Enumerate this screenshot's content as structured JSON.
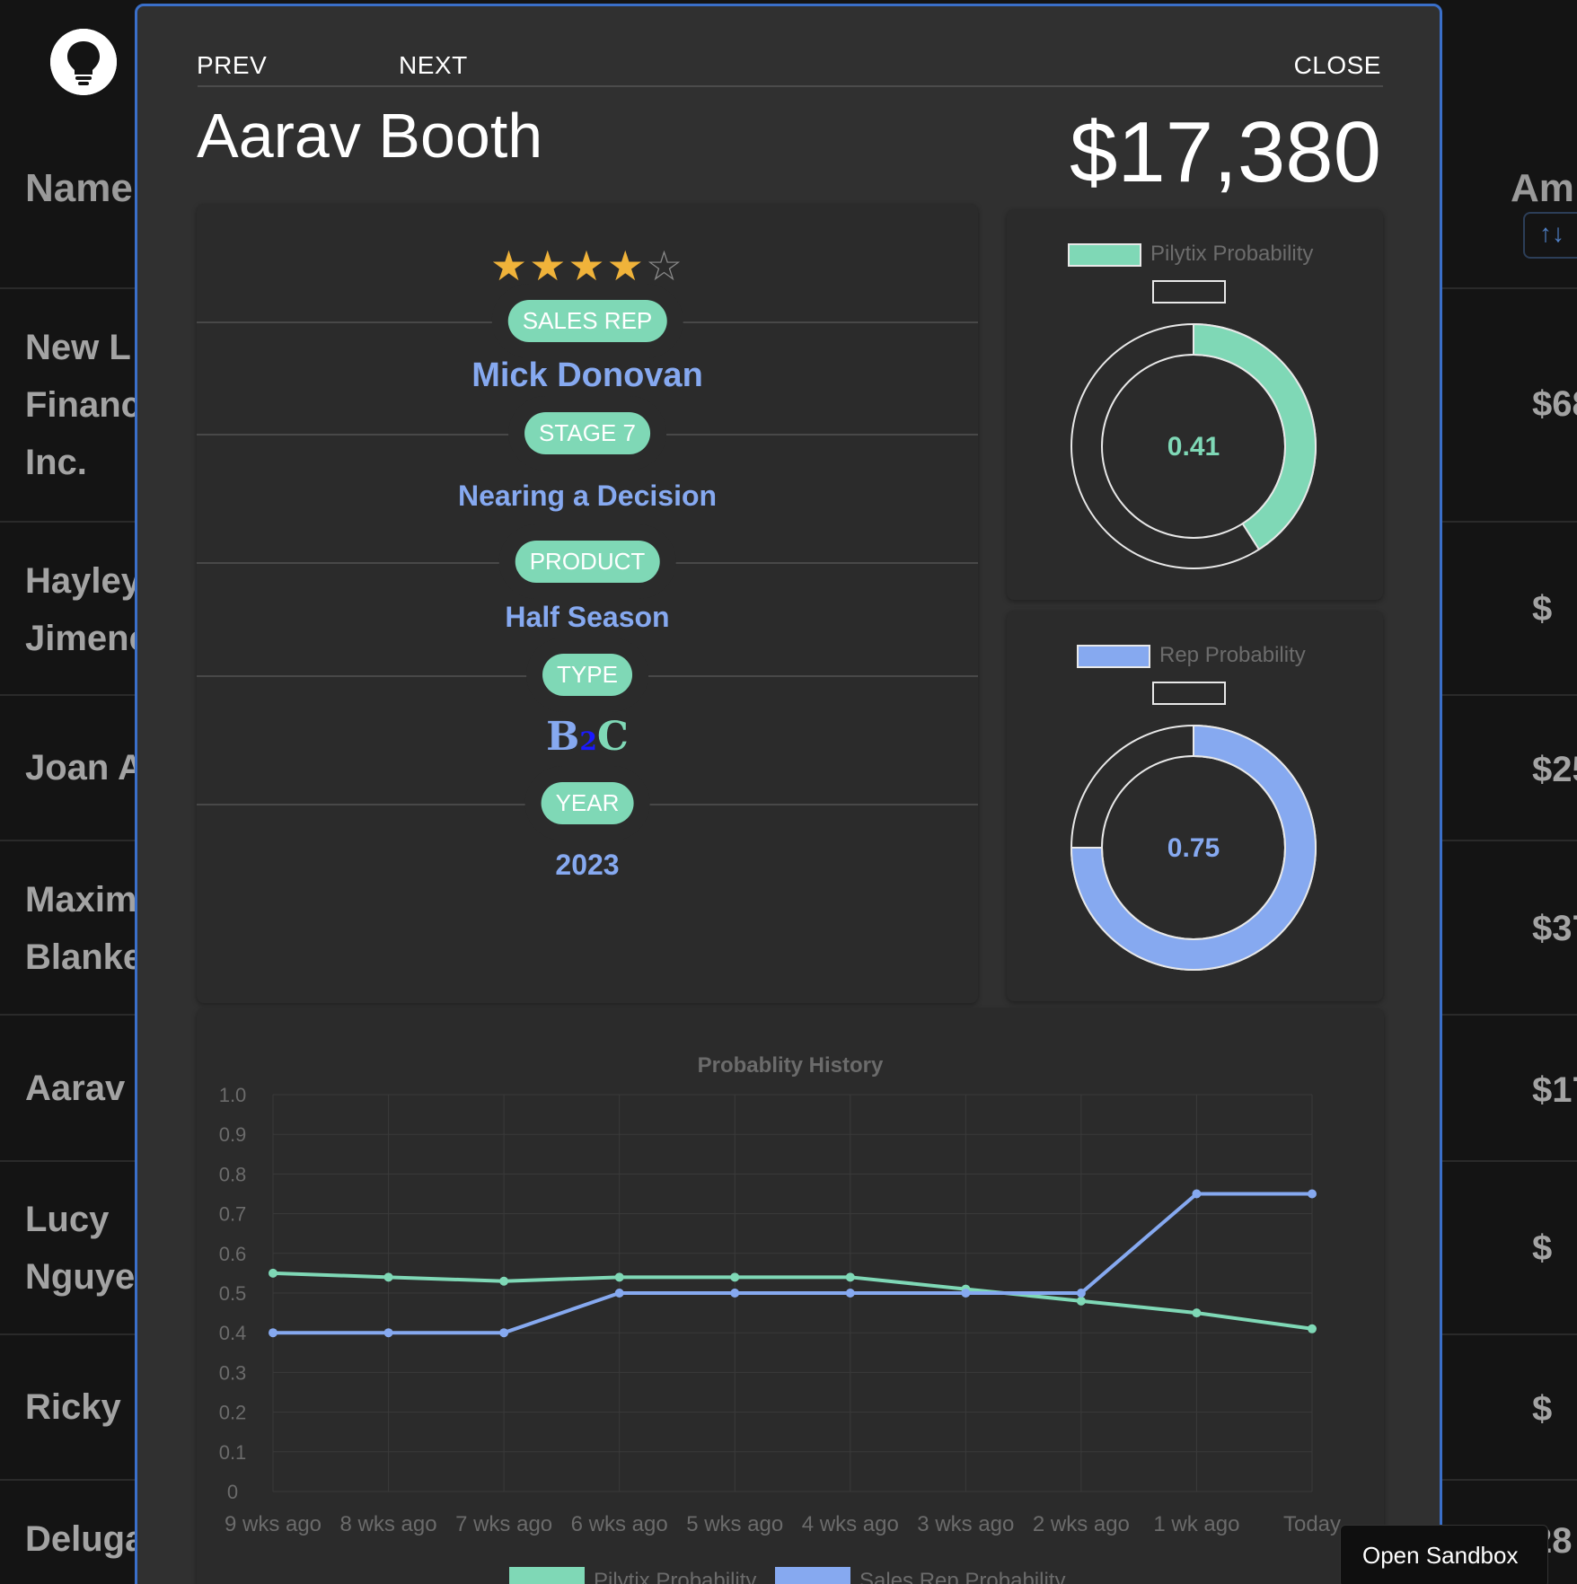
{
  "background": {
    "headers": {
      "name": "Name",
      "amount": "Am"
    },
    "rows": [
      {
        "name": "New L\nFinanc\nInc.",
        "amount": "$68"
      },
      {
        "name": "Hayley\nJimene",
        "amount": "$"
      },
      {
        "name": "Joan A",
        "amount": "$25"
      },
      {
        "name": "Maxim\nBlanke",
        "amount": "$37"
      },
      {
        "name": "Aarav",
        "amount": "$17"
      },
      {
        "name": "Lucy\nNguye",
        "amount": "$"
      },
      {
        "name": "Ricky",
        "amount": "$"
      },
      {
        "name": "Deluga",
        "amount": "28"
      }
    ],
    "sort_icon": "↑↓"
  },
  "modal": {
    "nav": {
      "prev": "PREV",
      "next": "NEXT",
      "close": "CLOSE"
    },
    "title": "Aarav Booth",
    "amount": "$17,380",
    "rating": {
      "value": 4,
      "max": 5
    },
    "details": {
      "sales_rep_label": "SALES REP",
      "sales_rep": "Mick Donovan",
      "stage_label": "STAGE 7",
      "stage": "Nearing a Decision",
      "product_label": "PRODUCT",
      "product": "Half Season",
      "type_label": "TYPE",
      "type_parts": [
        "B",
        "2",
        "C"
      ],
      "year_label": "YEAR",
      "year": "2023"
    },
    "donuts": [
      {
        "legend": "Pilytix Probability",
        "value": 0.41,
        "label": "0.41",
        "color": "#7fd8b6"
      },
      {
        "legend": "Rep Probability",
        "value": 0.75,
        "label": "0.75",
        "color": "#86a9f0"
      }
    ]
  },
  "chart_data": {
    "type": "line",
    "title": "Probablity History",
    "x": [
      "9 wks ago",
      "8 wks ago",
      "7 wks ago",
      "6 wks ago",
      "5 wks ago",
      "4 wks ago",
      "3 wks ago",
      "2 wks ago",
      "1 wk ago",
      "Today"
    ],
    "ylim": [
      0,
      1.0
    ],
    "yticks": [
      "1.0",
      "0.9",
      "0.8",
      "0.7",
      "0.6",
      "0.5",
      "0.4",
      "0.3",
      "0.2",
      "0.1",
      "0"
    ],
    "grid": true,
    "legend_position": "bottom",
    "series": [
      {
        "name": "Pilytix Probability",
        "color": "#7fd8b6",
        "values": [
          0.55,
          0.54,
          0.53,
          0.54,
          0.54,
          0.54,
          0.51,
          0.48,
          0.45,
          0.41
        ]
      },
      {
        "name": "Sales Rep Probability",
        "color": "#86a9f0",
        "values": [
          0.4,
          0.4,
          0.4,
          0.5,
          0.5,
          0.5,
          0.5,
          0.5,
          0.75,
          0.75
        ]
      }
    ]
  },
  "sandbox": {
    "label": "Open Sandbox"
  }
}
